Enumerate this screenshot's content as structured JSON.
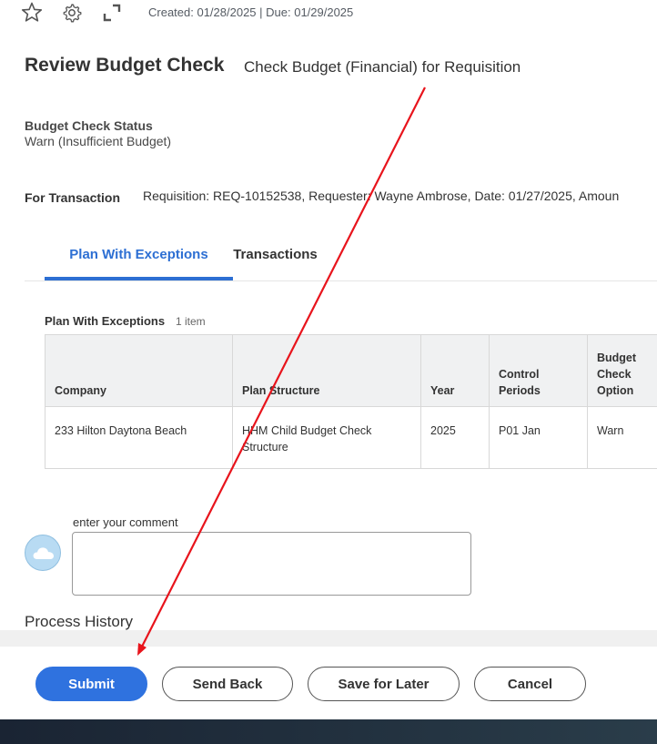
{
  "topbar": {
    "icons": [
      "star-icon",
      "gear-icon",
      "expand-icon"
    ],
    "meta_text": "Created: 01/28/2025 | Due: 01/29/2025"
  },
  "page": {
    "title": "Review Budget Check",
    "subtitle": "Check Budget (Financial) for Requisition"
  },
  "budget_check_status": {
    "label": "Budget Check Status",
    "value": "Warn (Insufficient Budget)"
  },
  "for_transaction": {
    "label": "For Transaction",
    "value": "Requisition: REQ-10152538, Requester: Wayne Ambrose, Date: 01/27/2025, Amoun"
  },
  "tabs": [
    {
      "label": "Plan With Exceptions",
      "active": true
    },
    {
      "label": "Transactions",
      "active": false
    }
  ],
  "grid": {
    "title": "Plan With Exceptions",
    "count": "1 item",
    "columns": [
      "Company",
      "Plan Structure",
      "Year",
      "Control Periods",
      "Budget Check Option"
    ],
    "rows": [
      [
        "233 Hilton Daytona Beach",
        "HHM Child Budget Check Structure",
        "2025",
        "P01 Jan",
        "Warn"
      ]
    ]
  },
  "comment": {
    "label": "enter your comment",
    "value": "",
    "avatar_icon": "cloud-icon"
  },
  "process_history": {
    "title": "Process History"
  },
  "actions": {
    "submit": "Submit",
    "send_back": "Send Back",
    "save_for_later": "Save for Later",
    "cancel": "Cancel"
  },
  "colors": {
    "accent": "#2f72df",
    "tab_active": "#2d6fd3",
    "annotation_arrow": "#e8141c",
    "footer_dark": "#1a2433"
  }
}
